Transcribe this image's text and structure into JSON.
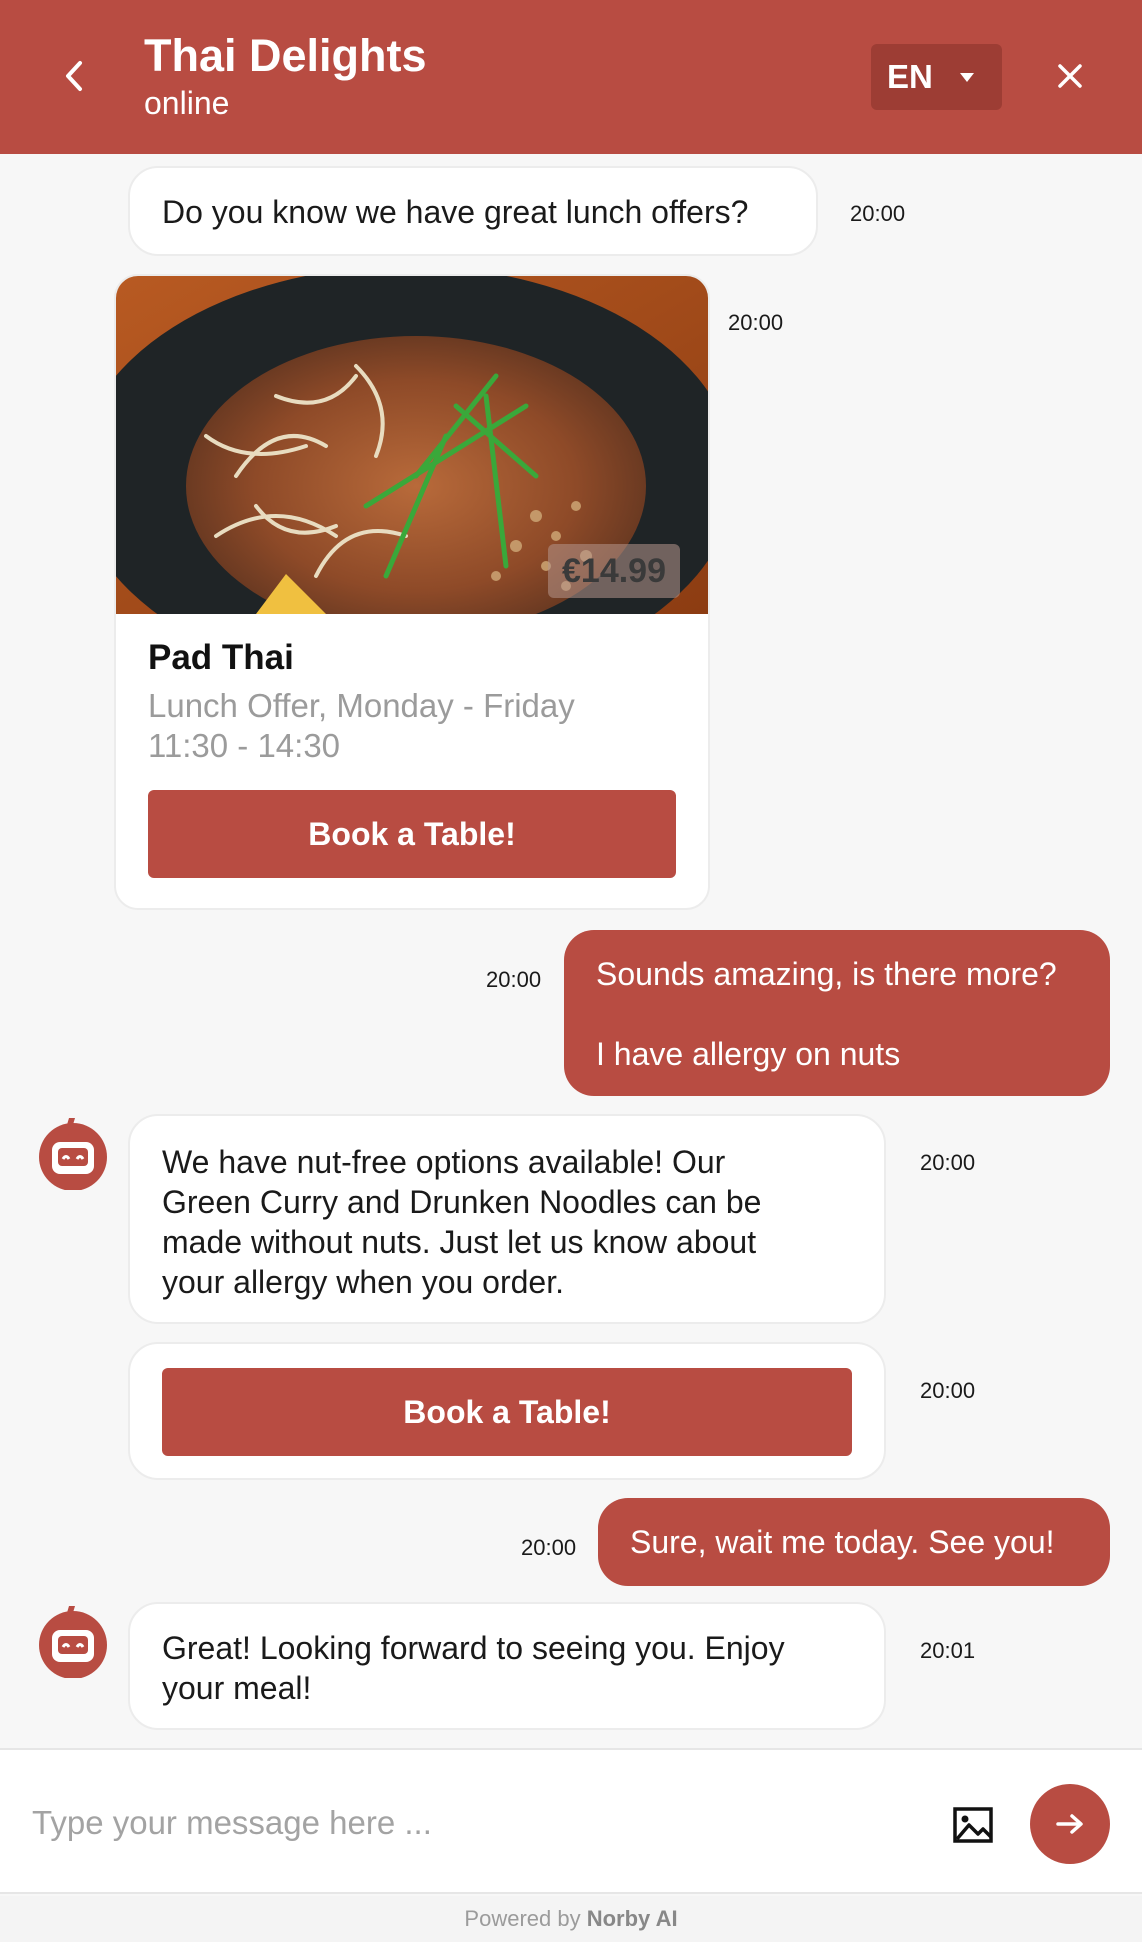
{
  "header": {
    "title": "Thai Delights",
    "status": "online",
    "language": "EN",
    "back_icon": "chevron-left-icon",
    "close_icon": "close-icon",
    "color": "#b84c42"
  },
  "messages": {
    "m1": {
      "text": "Do you know we have great lunch offers?",
      "time": "20:00"
    },
    "offer": {
      "time": "20:00",
      "price": "€14.99",
      "name": "Pad Thai",
      "desc_line1": "Lunch Offer, Monday - Friday",
      "desc_line2": "11:30 - 14:30",
      "button": "Book a Table!"
    },
    "u1": {
      "line1": "Sounds amazing, is there more?",
      "line2": "I have allergy on nuts",
      "time": "20:00"
    },
    "m2": {
      "line1": "We have nut-free options available! Our",
      "line2": "Green Curry and Drunken Noodles can be",
      "line3": "made without nuts. Just let us know about",
      "line4": "your allergy when you order.",
      "time": "20:00"
    },
    "m3": {
      "button": "Book a Table!",
      "time": "20:00"
    },
    "u2": {
      "text": "Sure, wait me today. See you!",
      "time": "20:00"
    },
    "m4": {
      "line1": "Great! Looking forward to seeing you. Enjoy",
      "line2": "your meal!",
      "time": "20:01"
    }
  },
  "composer": {
    "placeholder": "Type your message here ...",
    "image_icon": "image-icon",
    "send_icon": "arrow-right-icon"
  },
  "footer": {
    "prefix": "Powered by",
    "brand": "Norby AI"
  }
}
